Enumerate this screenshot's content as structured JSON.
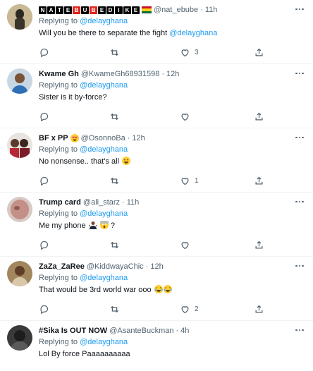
{
  "colors": {
    "link": "#1d9bf0",
    "secondary_text": "#536471",
    "divider": "#eff3f4"
  },
  "tweets": [
    {
      "display_name": "NATEBUBEDIKE",
      "name_letters": [
        "N",
        "A",
        "T",
        "E",
        "B",
        "U",
        "B",
        "E",
        "D",
        "I",
        "K",
        "E"
      ],
      "name_flag": "ghana-flag",
      "handle": "@nat_ebube",
      "dot": "·",
      "time": "11h",
      "replying_prefix": "Replying to",
      "replying_to": "@delayghana",
      "text": "Will you be there to separate the fight",
      "text_mention": "@delayghana",
      "like_count": "3"
    },
    {
      "display_name": "Kwame Gh",
      "handle": "@KwameGh68931598",
      "dot": "·",
      "time": "12h",
      "replying_prefix": "Replying to",
      "replying_to": "@delayghana",
      "text": "Sister is it by-force?",
      "like_count": ""
    },
    {
      "display_name": "BF x PP",
      "name_emoji": "heart-eyes-emoji",
      "handle": "@OsonnoBa",
      "dot": "·",
      "time": "12h",
      "replying_prefix": "Replying to",
      "replying_to": "@delayghana",
      "text": "No nonsense.. that's all",
      "text_emoji": "grinning-emoji",
      "like_count": "1"
    },
    {
      "display_name": "Trump card",
      "handle": "@ali_starz",
      "dot": "·",
      "time": "11h",
      "replying_prefix": "Replying to",
      "replying_to": "@delayghana",
      "text": "Me my phone",
      "text_emojis": [
        "person-shrugging-emoji",
        "screaming-emoji"
      ],
      "text_suffix": "?",
      "like_count": ""
    },
    {
      "display_name": "ZaZa_ZaRee",
      "handle": "@KiddwayaChic",
      "dot": "·",
      "time": "12h",
      "replying_prefix": "Replying to",
      "replying_to": "@delayghana",
      "text": "That would be 3rd world war ooo",
      "text_emojis": [
        "tears-of-joy-emoji",
        "tears-of-joy-emoji"
      ],
      "like_count": "2"
    },
    {
      "display_name": "#Sika Is OUT NOW",
      "handle": "@AsanteBuckman",
      "dot": "·",
      "time": "4h",
      "replying_prefix": "Replying to",
      "replying_to": "@delayghana",
      "text": "Lol By force Paaaaaaaaaa",
      "like_count": ""
    }
  ]
}
